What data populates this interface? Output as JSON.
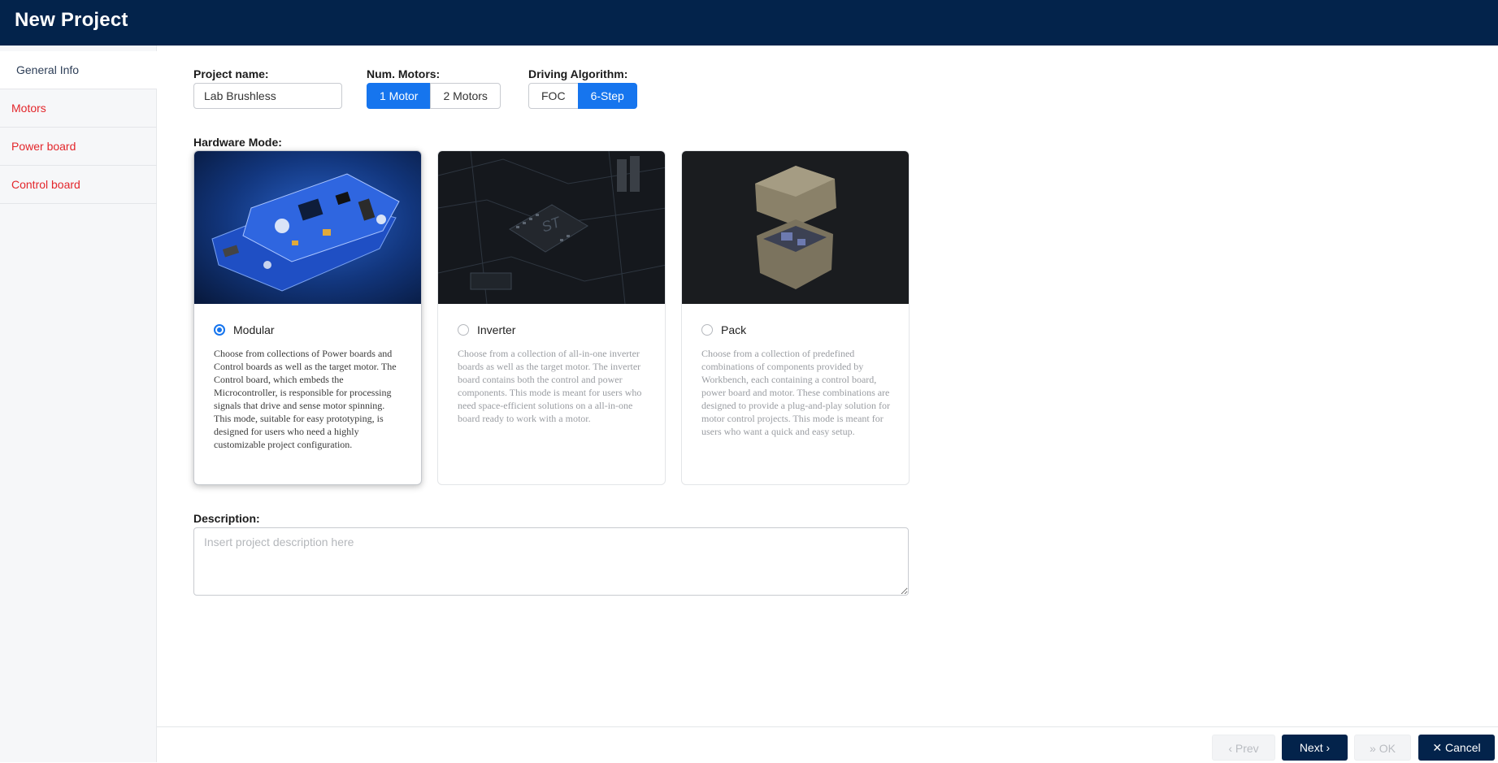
{
  "header": {
    "title": "New Project"
  },
  "sidebar": {
    "items": [
      {
        "label": "General Info"
      },
      {
        "label": "Motors"
      },
      {
        "label": "Power board"
      },
      {
        "label": "Control board"
      }
    ]
  },
  "form": {
    "project_name_label": "Project name:",
    "project_name_value": "Lab Brushless",
    "num_motors_label": "Num. Motors:",
    "num_motors_options": [
      "1 Motor",
      "2 Motors"
    ],
    "num_motors_selected": "1 Motor",
    "driving_algorithm_label": "Driving Algorithm:",
    "driving_algorithm_options": [
      "FOC",
      "6-Step"
    ],
    "driving_algorithm_selected": "6-Step",
    "hardware_mode_label": "Hardware Mode:",
    "hardware_modes": [
      {
        "name": "Modular",
        "selected": true,
        "description": "Choose from collections of Power boards and Control boards as well as the target motor. The Control board, which embeds the Microcontroller, is responsible for processing signals that drive and sense motor spinning. This mode, suitable for easy prototyping, is designed for users who need a highly customizable project configuration."
      },
      {
        "name": "Inverter",
        "selected": false,
        "description": "Choose from a collection of all-in-one inverter boards as well as the target motor. The inverter board contains both the control and power components. This mode is meant for users who need space-efficient solutions on a all-in-one board ready to work with a motor."
      },
      {
        "name": "Pack",
        "selected": false,
        "description": "Choose from a collection of predefined combinations of components provided by Workbench, each containing a control board, power board and motor. These combinations are designed to provide a plug-and-play solution for motor control projects. This mode is meant for users who want a quick and easy setup."
      }
    ],
    "description_label": "Description:",
    "description_placeholder": "Insert project description here"
  },
  "footer": {
    "prev_label": "Prev",
    "next_label": "Next",
    "ok_label": "OK",
    "cancel_label": "Cancel"
  },
  "colors": {
    "header_bg": "#03234b",
    "accent_blue": "#1675ee",
    "sidebar_link_red": "#e3262b"
  },
  "icons": {
    "prev": "chevron-left-icon",
    "next": "chevron-right-icon",
    "ok": "double-chevron-right-icon",
    "cancel": "close-icon"
  }
}
